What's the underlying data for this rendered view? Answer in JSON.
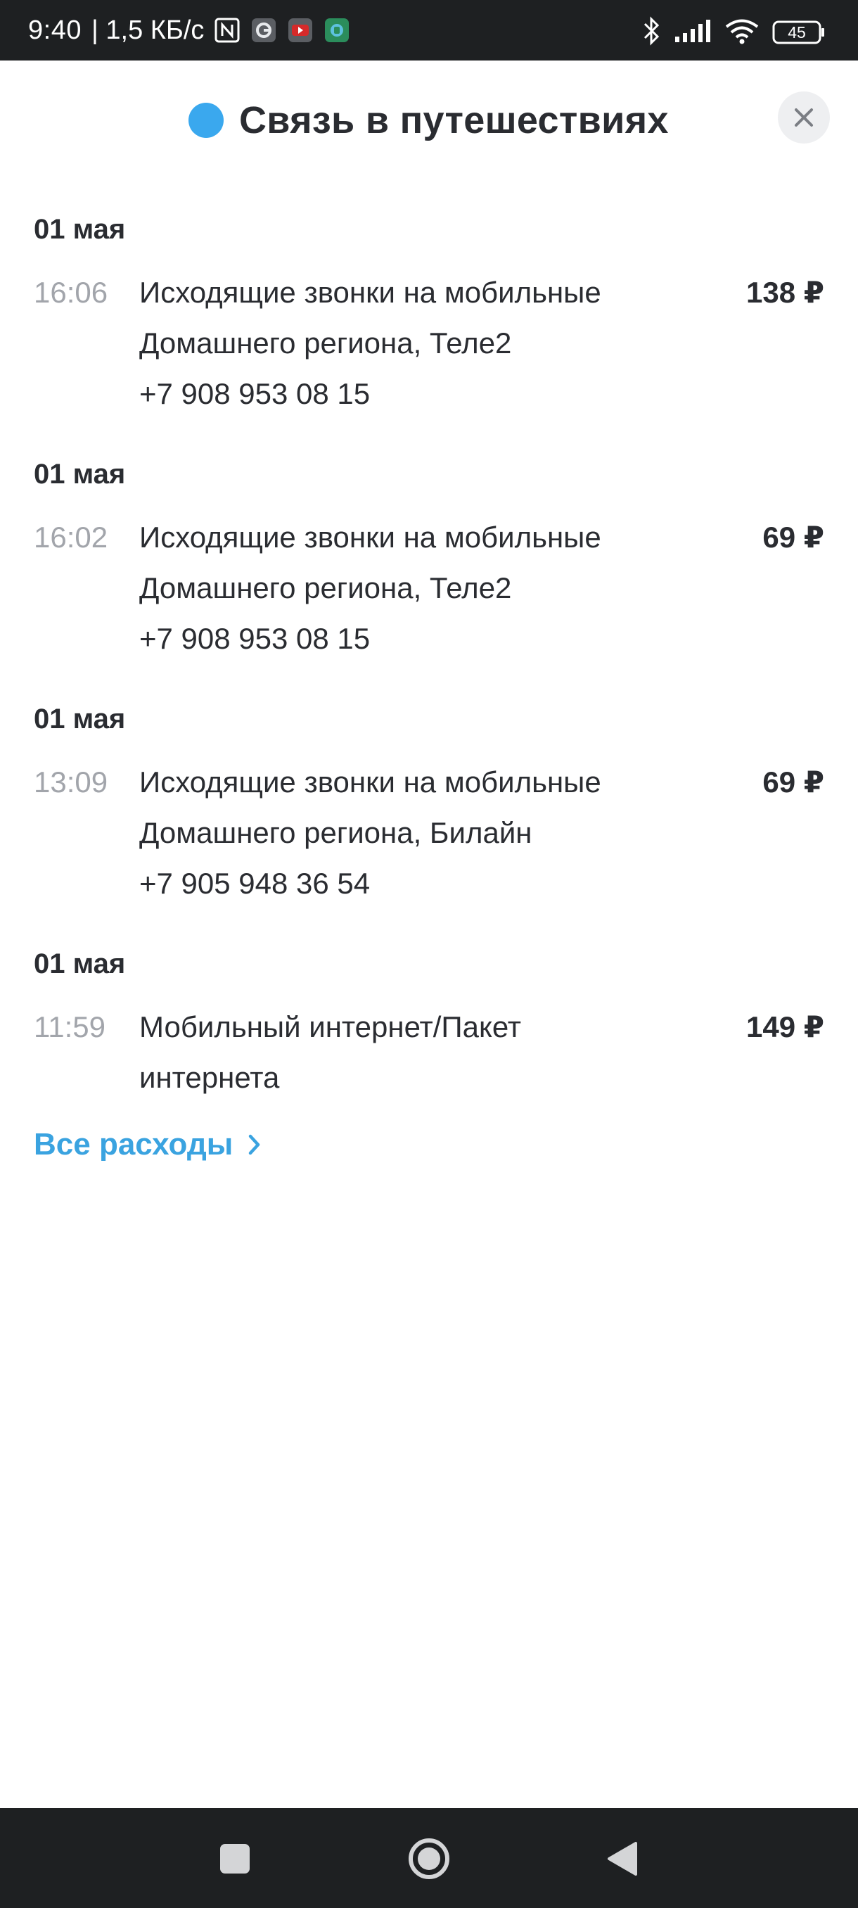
{
  "status_bar": {
    "time": "9:40",
    "speed": "| 1,5 КБ/с",
    "battery": "45",
    "icons": [
      "nfc-icon",
      "google-icon",
      "youtube-icon",
      "app-icon",
      "bluetooth-icon",
      "signal-icon",
      "wifi-icon",
      "battery-icon"
    ]
  },
  "header": {
    "title": "Связь в путешествиях",
    "dot_color": "#3aa8ee",
    "close_icon": "close-icon"
  },
  "transactions": [
    {
      "date": "01 мая",
      "time": "16:06",
      "lines": [
        "Исходящие звонки на мобильные",
        "Домашнего региона, Теле2",
        "+7 908 953 08 15"
      ],
      "amount": "138 ₽"
    },
    {
      "date": "01 мая",
      "time": "16:02",
      "lines": [
        "Исходящие звонки на мобильные",
        "Домашнего региона, Теле2",
        "+7 908 953 08 15"
      ],
      "amount": "69 ₽"
    },
    {
      "date": "01 мая",
      "time": "13:09",
      "lines": [
        "Исходящие звонки на мобильные",
        "Домашнего региона, Билайн",
        "+7 905 948 36 54"
      ],
      "amount": "69 ₽"
    },
    {
      "date": "01 мая",
      "time": "11:59",
      "lines": [
        "Мобильный интернет/Пакет",
        "интернета"
      ],
      "amount": "149 ₽"
    }
  ],
  "all_expenses": {
    "label": "Все расходы",
    "color": "#3aa3e0",
    "icon": "chevron-right-icon"
  },
  "nav_bar": {
    "buttons": [
      "recents-icon",
      "home-icon",
      "back-icon"
    ]
  }
}
